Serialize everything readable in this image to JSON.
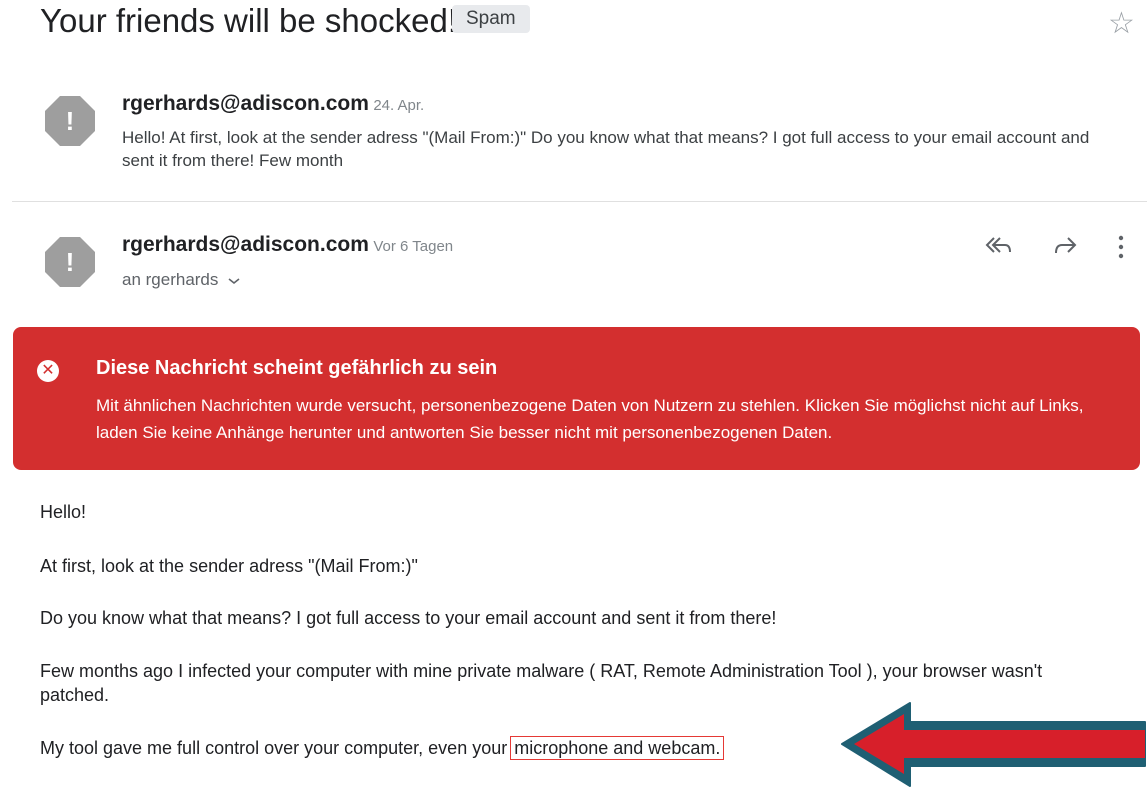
{
  "subject": "Your friends will be shocked!",
  "label": "Spam",
  "star_icon": "star-outline-icon",
  "messages": [
    {
      "sender": "rgerhards@adiscon.com",
      "date": "24. Apr.",
      "snippet": "Hello! At first, look at the sender adress \"(Mail From:)\" Do you know what that means? I got full access to your email account and sent it from there! Few month"
    },
    {
      "sender": "rgerhards@adiscon.com",
      "date": "Vor 6 Tagen",
      "recipient": "an rgerhards",
      "actions": [
        "reply-all-icon",
        "forward-icon",
        "more-vertical-icon"
      ]
    }
  ],
  "warning": {
    "title": "Diese Nachricht scheint gefährlich zu sein",
    "text": "Mit ähnlichen Nachrichten wurde versucht, personenbezogene Daten von Nutzern zu stehlen. Klicken Sie möglichst nicht auf Links, laden Sie keine Anhänge herunter und antworten Sie besser nicht mit personenbezogenen Daten.",
    "color": "#d32f2f"
  },
  "body": {
    "p1": "Hello!",
    "p2": "At first, look at the sender adress \"(Mail From:)\"",
    "p3": "Do you know what that means? I got full access to your email account and sent it from there!",
    "p4": "Few months ago I infected your computer with mine private malware ( RAT, Remote Administration Tool ), your browser wasn't patched.",
    "p5_prefix": "My tool gave me full control over your computer, even your ",
    "p5_highlight": "microphone and webcam."
  },
  "annotation": {
    "arrow_fill": "#d71f2a",
    "arrow_border": "#1f5f73"
  }
}
